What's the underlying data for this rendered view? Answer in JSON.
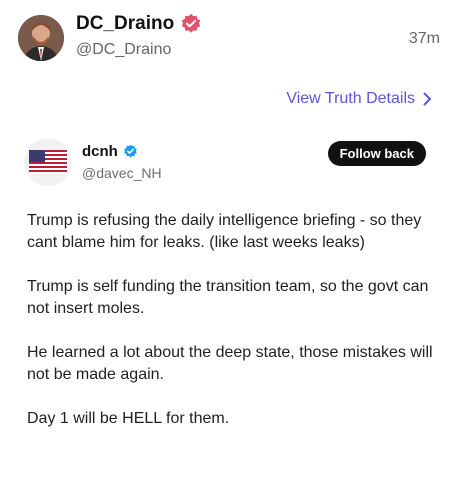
{
  "post": {
    "author_name": "DC_Draino",
    "author_handle": "@DC_Draino",
    "timestamp": "37m",
    "details_link": "View Truth Details",
    "accent_color": "#5a55d9",
    "badge_color": "#e0546b"
  },
  "embedded": {
    "name": "dcnh",
    "handle": "@davec_NH",
    "follow_label": "Follow back",
    "badge_color": "#1d9bf0",
    "paragraphs": [
      "Trump is refusing the daily intelligence briefing - so they cant blame him for leaks.  (like last weeks leaks)",
      "Trump is self funding the transition team, so the govt can not insert moles.",
      "He learned a lot about the deep state, those mistakes will not be made again.",
      "Day 1 will be HELL for them."
    ]
  }
}
